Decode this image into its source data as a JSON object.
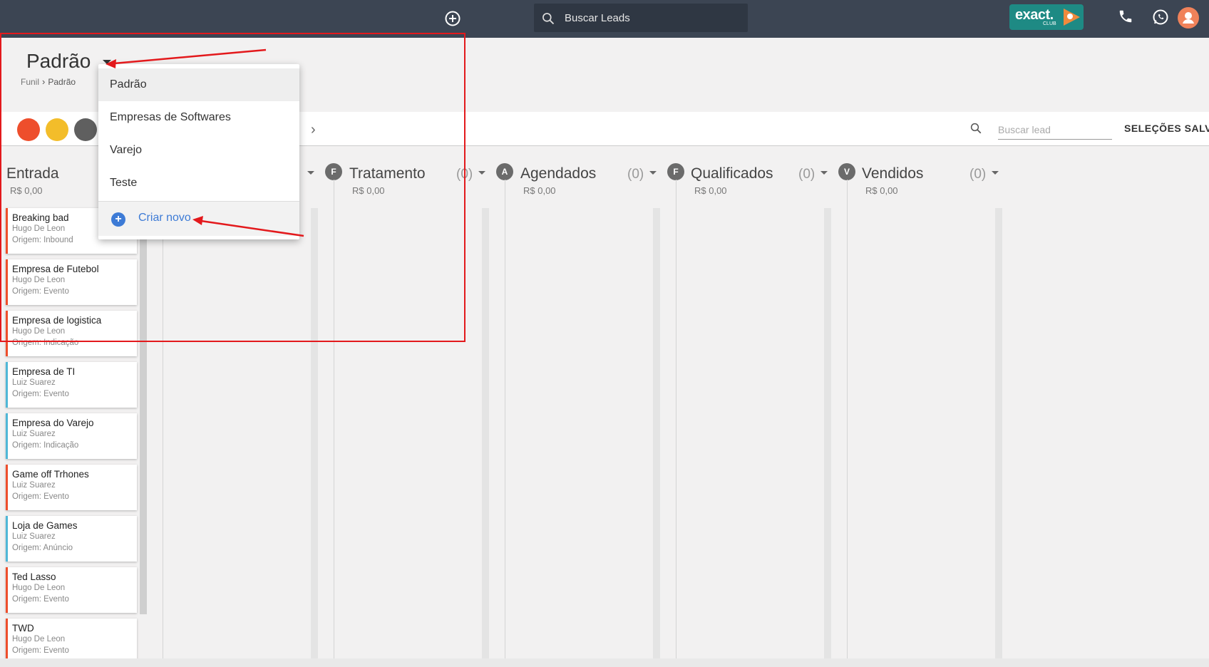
{
  "topbar": {
    "add_icon": "plus-circle-icon",
    "search_placeholder": "Buscar Leads",
    "logo_text": "exact.",
    "logo_sub": "CLUB",
    "phone_icon": "phone-icon",
    "whatsapp_icon": "whatsapp-icon",
    "avatar_icon": "user-avatar"
  },
  "header": {
    "title": "Padrão",
    "breadcrumb": [
      "Funil",
      "Padrão"
    ]
  },
  "filterbar": {
    "dot_colors": [
      "#ee4e2c",
      "#f3bd2a",
      "#5f5f5f"
    ],
    "lead_search_placeholder": "Buscar lead",
    "saved_label": "SELEÇÕES SALVA"
  },
  "dropdown": {
    "items": [
      "Padrão",
      "Empresas de Softwares",
      "Varejo",
      "Teste"
    ],
    "selected": "Padrão",
    "create_label": "Criar novo"
  },
  "columns": [
    {
      "title": "Entrada",
      "badge": "",
      "count": "",
      "value": "R$ 0,00"
    },
    {
      "title": "",
      "badge": "",
      "count": ")",
      "value": ""
    },
    {
      "title": "Tratamento",
      "badge": "F",
      "count": "(0)",
      "value": "R$ 0,00"
    },
    {
      "title": "Agendados",
      "badge": "A",
      "count": "(0)",
      "value": "R$ 0,00"
    },
    {
      "title": "Qualificados",
      "badge": "F",
      "count": "(0)",
      "value": "R$ 0,00"
    },
    {
      "title": "Vendidos",
      "badge": "V",
      "count": "(0)",
      "value": "R$ 0,00"
    }
  ],
  "cards": [
    {
      "name": "Breaking bad",
      "owner": "Hugo De Leon",
      "origin": "Origem: Inbound",
      "color": "#ee4e2c"
    },
    {
      "name": "Empresa de Futebol",
      "owner": "Hugo De Leon",
      "origin": "Origem: Evento",
      "color": "#ee4e2c"
    },
    {
      "name": "Empresa de logistica",
      "owner": "Hugo De Leon",
      "origin": "Origem: Indicação",
      "color": "#ee4e2c"
    },
    {
      "name": "Empresa de TI",
      "owner": "Luiz Suarez",
      "origin": "Origem: Evento",
      "color": "#4fb7d7"
    },
    {
      "name": "Empresa do Varejo",
      "owner": "Luiz Suarez",
      "origin": "Origem: Indicação",
      "color": "#4fb7d7"
    },
    {
      "name": "Game off Trhones",
      "owner": "Luiz Suarez",
      "origin": "Origem: Evento",
      "color": "#ee4e2c"
    },
    {
      "name": "Loja de Games",
      "owner": "Luiz Suarez",
      "origin": "Origem: Anúncio",
      "color": "#4fb7d7"
    },
    {
      "name": "Ted Lasso",
      "owner": "Hugo De Leon",
      "origin": "Origem: Evento",
      "color": "#ee4e2c"
    },
    {
      "name": "TWD",
      "owner": "Hugo De Leon",
      "origin": "Origem: Evento",
      "color": "#ee4e2c"
    }
  ]
}
